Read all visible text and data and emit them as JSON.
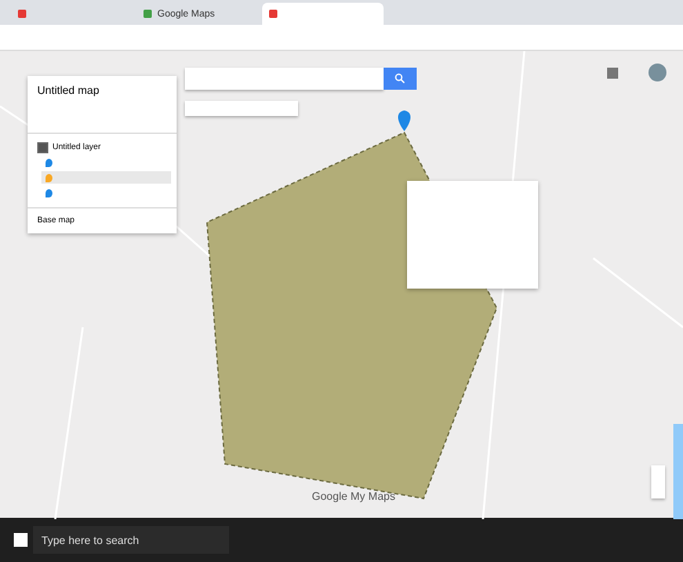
{
  "browser": {
    "tabs": [
      {
        "color": "#e53935",
        "selected": false
      },
      {
        "label": "Google Maps",
        "color": "#43a047",
        "selected": false
      },
      {
        "color": "#e53935",
        "selected": true
      }
    ]
  },
  "sidebar": {
    "title": "Untitled map",
    "layer": {
      "label": "Untitled layer",
      "checked": true,
      "features": [
        {
          "color": "#1e88e5",
          "selected": false
        },
        {
          "color": "#f9a825",
          "selected": true
        },
        {
          "color": "#1e88e5",
          "selected": false
        }
      ]
    },
    "base_map": "Base map"
  },
  "map": {
    "logo": "Google My Maps"
  },
  "taskbar": {
    "search": {
      "placeholder": "Type here to search"
    }
  }
}
